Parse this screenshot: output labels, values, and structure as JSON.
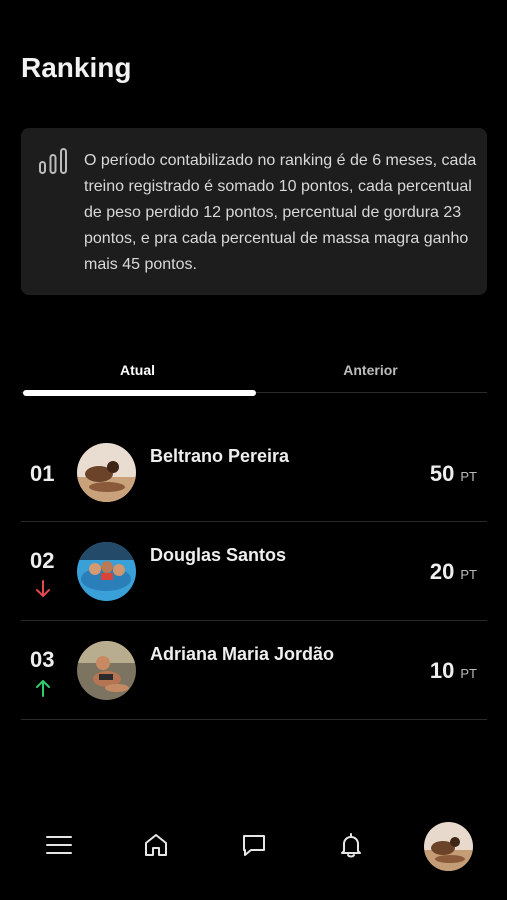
{
  "header": {
    "title": "Ranking"
  },
  "info": {
    "icon": "bar-chart-icon",
    "text": "O período contabilizado no ranking é de 6 meses, cada treino registrado é somado 10 pontos, cada percentual de peso perdido 12 pontos, percentual de gordura 23 pontos, e pra cada percentual de massa magra ganho mais 45 pontos."
  },
  "tabs": [
    {
      "label": "Atual",
      "active": true
    },
    {
      "label": "Anterior",
      "active": false
    }
  ],
  "ranking": [
    {
      "position": "01",
      "name": "Beltrano Pereira",
      "points": "50",
      "unit": "PT",
      "trend": "none"
    },
    {
      "position": "02",
      "name": "Douglas Santos",
      "points": "20",
      "unit": "PT",
      "trend": "down"
    },
    {
      "position": "03",
      "name": "Adriana Maria Jordão",
      "points": "10",
      "unit": "PT",
      "trend": "up"
    }
  ],
  "colors": {
    "background": "#000000",
    "card": "#1d1d1d",
    "trend_down": "#e5484d",
    "trend_up": "#2ecc71"
  },
  "bottom_nav": {
    "icons": [
      "menu-icon",
      "home-icon",
      "chat-icon",
      "bell-icon",
      "profile-avatar"
    ]
  }
}
